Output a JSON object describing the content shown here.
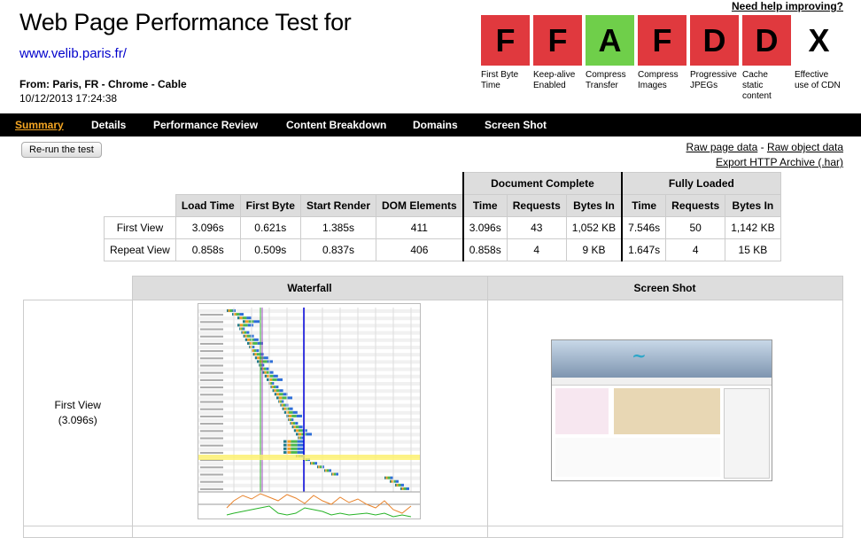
{
  "header": {
    "title": "Web Page Performance Test for",
    "url": "www.velib.paris.fr/",
    "from": "From: Paris, FR - Chrome - Cable",
    "date": "10/12/2013 17:24:38",
    "help": "Need help improving?"
  },
  "grades": [
    {
      "letter": "F",
      "label": "First Byte Time",
      "color": "#e0393e"
    },
    {
      "letter": "F",
      "label": "Keep-alive Enabled",
      "color": "#e0393e"
    },
    {
      "letter": "A",
      "label": "Compress Transfer",
      "color": "#6fcf4a"
    },
    {
      "letter": "F",
      "label": "Compress Images",
      "color": "#e0393e"
    },
    {
      "letter": "D",
      "label": "Progressive JPEGs",
      "color": "#e0393e"
    },
    {
      "letter": "D",
      "label": "Cache static content",
      "color": "#e0393e"
    },
    {
      "letter": "X",
      "label": "Effective use of CDN",
      "color": "#ffffff"
    }
  ],
  "nav": [
    "Summary",
    "Details",
    "Performance Review",
    "Content Breakdown",
    "Domains",
    "Screen Shot"
  ],
  "rerun": "Re-run the test",
  "links": {
    "raw_page": "Raw page data",
    "sep": " - ",
    "raw_object": "Raw object data",
    "export": "Export HTTP Archive (.har)"
  },
  "metrics": {
    "group_doc": "Document Complete",
    "group_full": "Fully Loaded",
    "headers": [
      "Load Time",
      "First Byte",
      "Start Render",
      "DOM Elements",
      "Time",
      "Requests",
      "Bytes In",
      "Time",
      "Requests",
      "Bytes In"
    ],
    "rows": [
      {
        "label": "First View",
        "cells": [
          "3.096s",
          "0.621s",
          "1.385s",
          "411",
          "3.096s",
          "43",
          "1,052 KB",
          "7.546s",
          "50",
          "1,142 KB"
        ]
      },
      {
        "label": "Repeat View",
        "cells": [
          "0.858s",
          "0.509s",
          "0.837s",
          "406",
          "0.858s",
          "4",
          "9 KB",
          "1.647s",
          "4",
          "15 KB"
        ]
      }
    ]
  },
  "summary": {
    "waterfall": "Waterfall",
    "screenshot": "Screen Shot",
    "view": "First View",
    "time": "(3.096s)"
  }
}
